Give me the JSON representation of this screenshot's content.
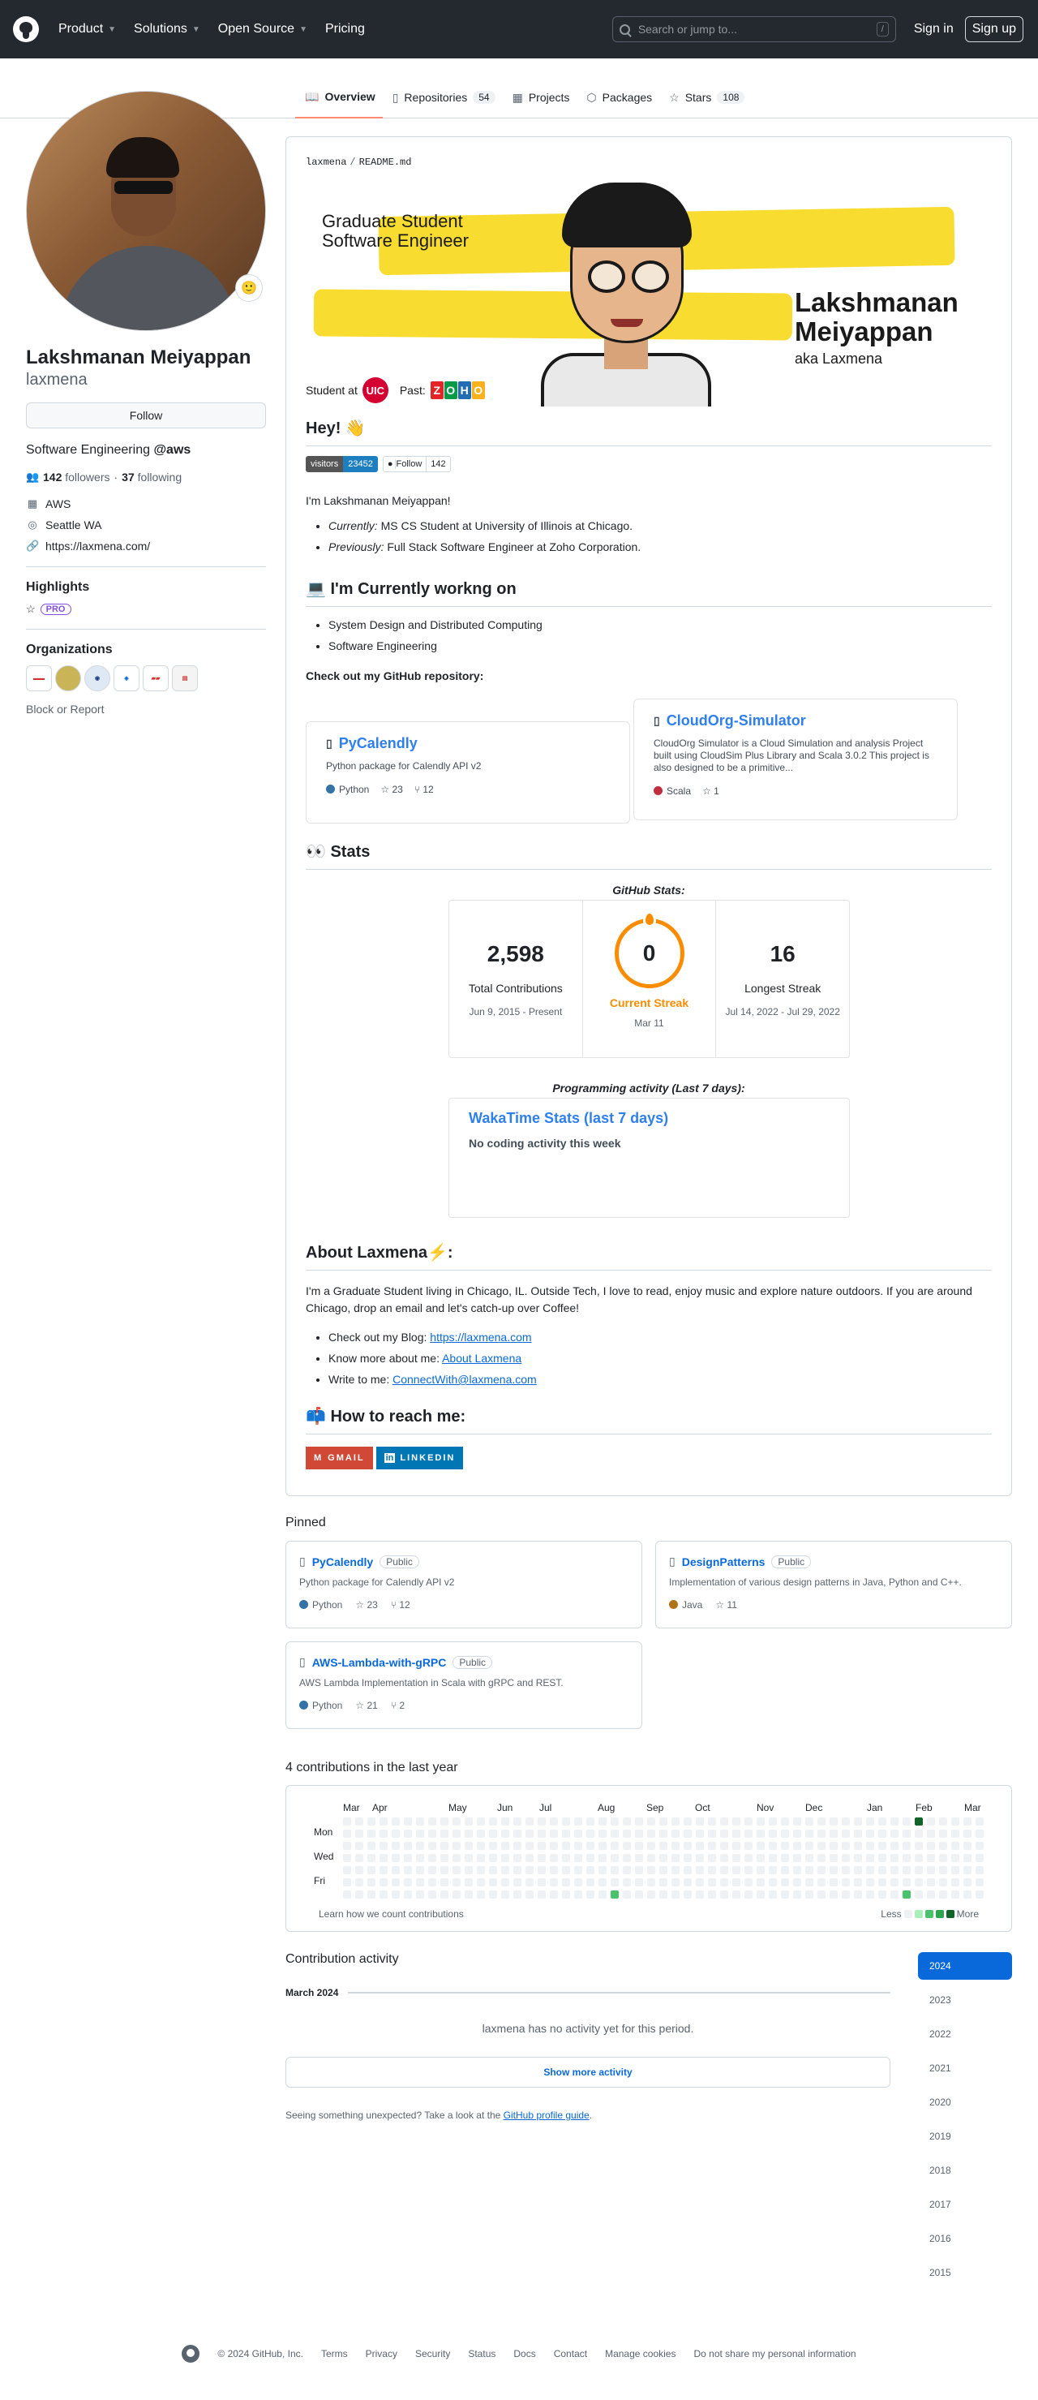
{
  "header": {
    "nav": [
      "Product",
      "Solutions",
      "Open Source",
      "Pricing"
    ],
    "search_placeholder": "Search or jump to...",
    "search_key": "/",
    "sign_in": "Sign in",
    "sign_up": "Sign up"
  },
  "tabs": [
    {
      "label": "Overview",
      "icon": "book-icon"
    },
    {
      "label": "Repositories",
      "icon": "repo-icon",
      "count": "54"
    },
    {
      "label": "Projects",
      "icon": "table-icon"
    },
    {
      "label": "Packages",
      "icon": "package-icon"
    },
    {
      "label": "Stars",
      "icon": "star-icon",
      "count": "108"
    }
  ],
  "profile": {
    "name": "Lakshmanan Meiyappan",
    "username": "laxmena",
    "follow": "Follow",
    "bio_prefix": "Software Engineering ",
    "bio_handle": "@aws",
    "followers_count": "142",
    "followers_label": "followers",
    "dot": "·",
    "following_count": "37",
    "following_label": "following",
    "company": "AWS",
    "location": "Seattle WA",
    "website": "https://laxmena.com/",
    "highlights_title": "Highlights",
    "pro": "PRO",
    "orgs_title": "Organizations",
    "block": "Block or Report"
  },
  "readme": {
    "path_user": "laxmena",
    "path_sep": "/",
    "path_file": "README.md",
    "banner": {
      "line1": "Graduate Student",
      "line2": "Software Engineer",
      "name1": "Lakshmanan",
      "name2": "Meiyappan",
      "aka": "aka Laxmena",
      "student_at": "Student at",
      "uic": "UIC",
      "past": "Past:",
      "zoho": [
        "Z",
        "O",
        "H",
        "O"
      ]
    },
    "hey": "Hey! 👋",
    "visitors_label": "visitors",
    "visitors_count": "23452",
    "gh_follow": "Follow",
    "gh_follow_count": "142",
    "intro": "I'm Lakshmanan Meiyappan!",
    "currently_label": "Currently:",
    "currently_text": " MS CS Student at University of Illinois at Chicago.",
    "previously_label": "Previously:",
    "previously_text": " Full Stack Software Engineer at Zoho Corporation.",
    "working_title": "💻 I'm Currently workng on",
    "working": [
      "System Design and Distributed Computing",
      "Software Engineering"
    ],
    "checkout": "Check out my GitHub repository:",
    "cards": [
      {
        "name": "PyCalendly",
        "desc": "Python package for Calendly API v2",
        "lang": "Python",
        "lang_color": "#3572A5",
        "stars": "23",
        "forks": "12"
      },
      {
        "name": "CloudOrg-Simulator",
        "desc": "CloudOrg Simulator is a Cloud Simulation and analysis Project built using CloudSim Plus Library and Scala 3.0.2 This project is also designed to be a primitive...",
        "lang": "Scala",
        "lang_color": "#c22d40",
        "stars": "1"
      }
    ],
    "stats_title": "👀 Stats",
    "github_stats": "GitHub Stats:",
    "streak": {
      "total": "2,598",
      "total_label": "Total Contributions",
      "total_range": "Jun 9, 2015 - Present",
      "current": "0",
      "current_label": "Current Streak",
      "current_date": "Mar 11",
      "longest": "16",
      "longest_label": "Longest Streak",
      "longest_range": "Jul 14, 2022 - Jul 29, 2022"
    },
    "prog_title": "Programming activity (Last 7 days):",
    "waka_title": "WakaTime Stats (last 7 days)",
    "waka_sub": "No coding activity this week",
    "about_title": "About Laxmena⚡:",
    "about_text": "I'm a Graduate Student living in Chicago, IL. Outside Tech, I love to read, enjoy music and explore nature outdoors. If you are around Chicago, drop an email and let's catch-up over Coffee!",
    "links": [
      {
        "prefix": "Check out my Blog: ",
        "link": "https://laxmena.com"
      },
      {
        "prefix": "Know more about me: ",
        "link": "About Laxmena"
      },
      {
        "prefix": "Write to me: ",
        "link": "ConnectWith@laxmena.com"
      }
    ],
    "reach_title": "📫 How to reach me:",
    "gmail": "GMAIL",
    "linkedin": "LINKEDIN"
  },
  "pinned_title": "Pinned",
  "pinned": [
    {
      "name": "PyCalendly",
      "visibility": "Public",
      "desc": "Python package for Calendly API v2",
      "lang": "Python",
      "lang_color": "#3572A5",
      "stars": "23",
      "forks": "12"
    },
    {
      "name": "DesignPatterns",
      "visibility": "Public",
      "desc": "Implementation of various design patterns in Java, Python and C++.",
      "lang": "Java",
      "lang_color": "#b07219",
      "stars": "11"
    },
    {
      "name": "AWS-Lambda-with-gRPC",
      "visibility": "Public",
      "desc": "AWS Lambda Implementation in Scala with gRPC and REST.",
      "lang": "Python",
      "lang_color": "#3572A5",
      "stars": "21",
      "forks": "2"
    }
  ],
  "contributions": {
    "title": "4 contributions in the last year",
    "months": [
      "Mar",
      "Apr",
      "May",
      "Jun",
      "Jul",
      "Aug",
      "Sep",
      "Oct",
      "Nov",
      "Dec",
      "Jan",
      "Feb",
      "Mar"
    ],
    "days": [
      "Mon",
      "Wed",
      "Fri"
    ],
    "learn": "Learn how we count contributions",
    "less": "Less",
    "more": "More",
    "level_colors": [
      "#eff2f5",
      "#aceebb",
      "#4ac26b",
      "#2da44e",
      "#116329"
    ],
    "active_cells": [
      {
        "week": 22,
        "day": 6,
        "level": 2
      },
      {
        "week": 47,
        "day": 0,
        "level": 4
      },
      {
        "week": 46,
        "day": 6,
        "level": 2
      }
    ]
  },
  "activity": {
    "title": "Contribution activity",
    "month": "March 2024",
    "none": "laxmena has no activity yet for this period.",
    "show_more": "Show more activity",
    "unexpected": "Seeing something unexpected? Take a look at the ",
    "guide": "GitHub profile guide",
    "period": ".",
    "years": [
      "2024",
      "2023",
      "2022",
      "2021",
      "2020",
      "2019",
      "2018",
      "2017",
      "2016",
      "2015"
    ]
  },
  "footer": [
    "© 2024 GitHub, Inc.",
    "Terms",
    "Privacy",
    "Security",
    "Status",
    "Docs",
    "Contact",
    "Manage cookies",
    "Do not share my personal information"
  ]
}
